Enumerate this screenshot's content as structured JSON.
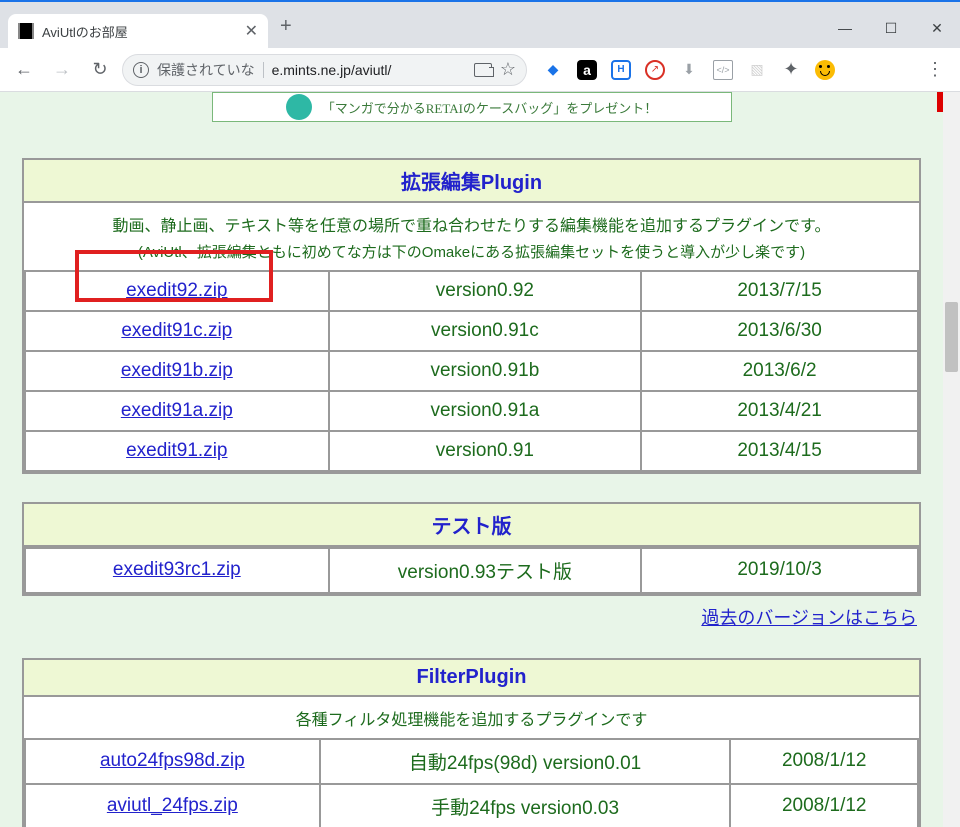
{
  "browser": {
    "tab_title": "AviUtlのお部屋",
    "url_prefix": "保護されていな",
    "url": "e.mints.ne.jp/aviutl/"
  },
  "banner_text": "「マンガで分かるRETAIのケースバッグ」をプレゼント！",
  "sections": {
    "exedit": {
      "title": "拡張編集Plugin",
      "desc1": "動画、静止画、テキスト等を任意の場所で重ね合わせたりする編集機能を追加するプラグインです。",
      "desc2": "(AviUtl、拡張編集ともに初めてな方は下のOmakeにある拡張編集セットを使うと導入が少し楽です)",
      "rows": [
        {
          "file": "exedit92.zip",
          "version": "version0.92",
          "date": "2013/7/15"
        },
        {
          "file": "exedit91c.zip",
          "version": "version0.91c",
          "date": "2013/6/30"
        },
        {
          "file": "exedit91b.zip",
          "version": "version0.91b",
          "date": "2013/6/2"
        },
        {
          "file": "exedit91a.zip",
          "version": "version0.91a",
          "date": "2013/4/21"
        },
        {
          "file": "exedit91.zip",
          "version": "version0.91",
          "date": "2013/4/15"
        }
      ]
    },
    "test": {
      "title": "テスト版",
      "rows": [
        {
          "file": "exedit93rc1.zip",
          "version": "version0.93テスト版",
          "date": "2019/10/3"
        }
      ]
    },
    "past_link": "過去のバージョンはこちら",
    "filter": {
      "title": "FilterPlugin",
      "desc": "各種フィルタ処理機能を追加するプラグインです",
      "rows": [
        {
          "file": "auto24fps98d.zip",
          "version": "自動24fps(98d) version0.01",
          "date": "2008/1/12"
        },
        {
          "file": "aviutl_24fps.zip",
          "version": "手動24fps version0.03",
          "date": "2008/1/12"
        }
      ]
    }
  }
}
